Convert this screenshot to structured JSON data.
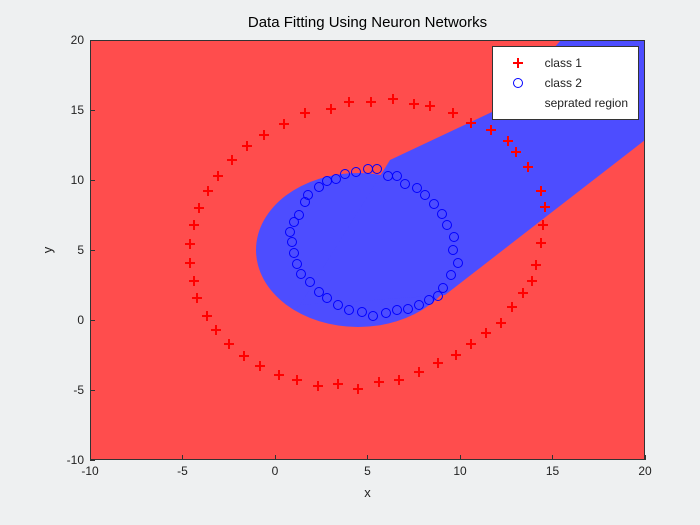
{
  "title": "Data Fitting Using Neuron Networks",
  "xlabel": "x",
  "ylabel": "y",
  "legend": {
    "class1": "class 1",
    "class2": "class 2",
    "region": "seprated region"
  },
  "chart_data": {
    "type": "scatter",
    "title": "Data Fitting Using Neuron Networks",
    "xlabel": "x",
    "ylabel": "y",
    "xlim": [
      -10,
      20
    ],
    "ylim": [
      -10,
      20
    ],
    "xticks": [
      -10,
      -5,
      0,
      5,
      10,
      15,
      20
    ],
    "yticks": [
      -10,
      -5,
      0,
      5,
      10,
      15,
      20
    ],
    "region": {
      "description": "Two classification regions. Red covers most of the plane; a rounded blue lobe centered near (4.5,5) with radius ~5.5 extends diagonally to the top-right corner as a band roughly 9 units wide.",
      "red_color": "#ff4d4d",
      "blue_color": "#4d4dff"
    },
    "series": [
      {
        "name": "class 1",
        "marker": "plus",
        "color": "#ff0000",
        "points": [
          [
            14.6,
            8.1
          ],
          [
            14.4,
            9.2
          ],
          [
            13.7,
            10.9
          ],
          [
            13.0,
            12.0
          ],
          [
            12.6,
            12.8
          ],
          [
            11.7,
            13.6
          ],
          [
            10.6,
            14.1
          ],
          [
            9.6,
            14.8
          ],
          [
            8.4,
            15.3
          ],
          [
            7.5,
            15.4
          ],
          [
            6.4,
            15.8
          ],
          [
            5.2,
            15.6
          ],
          [
            4.0,
            15.6
          ],
          [
            3.0,
            15.1
          ],
          [
            1.6,
            14.8
          ],
          [
            0.5,
            14.0
          ],
          [
            -0.6,
            13.2
          ],
          [
            -1.5,
            12.4
          ],
          [
            -2.3,
            11.4
          ],
          [
            -3.1,
            10.3
          ],
          [
            -3.6,
            9.2
          ],
          [
            -4.1,
            8.0
          ],
          [
            -4.4,
            6.8
          ],
          [
            -4.6,
            5.4
          ],
          [
            -4.6,
            4.1
          ],
          [
            -4.4,
            2.8
          ],
          [
            -4.2,
            1.6
          ],
          [
            -3.7,
            0.3
          ],
          [
            -3.2,
            -0.7
          ],
          [
            -2.5,
            -1.7
          ],
          [
            -1.7,
            -2.6
          ],
          [
            -0.8,
            -3.3
          ],
          [
            0.2,
            -3.9
          ],
          [
            1.2,
            -4.3
          ],
          [
            2.3,
            -4.7
          ],
          [
            3.4,
            -4.6
          ],
          [
            4.5,
            -4.9
          ],
          [
            5.6,
            -4.4
          ],
          [
            6.7,
            -4.3
          ],
          [
            7.8,
            -3.7
          ],
          [
            8.8,
            -3.1
          ],
          [
            9.8,
            -2.5
          ],
          [
            10.6,
            -1.7
          ],
          [
            11.4,
            -0.9
          ],
          [
            12.2,
            -0.2
          ],
          [
            12.8,
            0.9
          ],
          [
            13.4,
            1.9
          ],
          [
            13.9,
            2.8
          ],
          [
            14.1,
            3.9
          ],
          [
            14.4,
            5.5
          ],
          [
            14.5,
            6.8
          ]
        ]
      },
      {
        "name": "class 2",
        "marker": "circle",
        "color": "#0000ff",
        "points": [
          [
            9.9,
            4.1
          ],
          [
            9.6,
            5.0
          ],
          [
            9.7,
            5.9
          ],
          [
            9.3,
            6.8
          ],
          [
            9.0,
            7.6
          ],
          [
            8.6,
            8.3
          ],
          [
            8.1,
            8.9
          ],
          [
            7.7,
            9.4
          ],
          [
            7.0,
            9.7
          ],
          [
            6.6,
            10.3
          ],
          [
            6.1,
            10.3
          ],
          [
            5.5,
            10.8
          ],
          [
            5.0,
            10.8
          ],
          [
            4.4,
            10.6
          ],
          [
            3.8,
            10.4
          ],
          [
            3.3,
            10.1
          ],
          [
            2.8,
            9.9
          ],
          [
            2.4,
            9.5
          ],
          [
            1.8,
            8.9
          ],
          [
            1.6,
            8.4
          ],
          [
            1.3,
            7.5
          ],
          [
            1.0,
            7.0
          ],
          [
            0.8,
            6.3
          ],
          [
            0.9,
            5.6
          ],
          [
            1.0,
            4.8
          ],
          [
            1.2,
            4.0
          ],
          [
            1.4,
            3.3
          ],
          [
            1.9,
            2.7
          ],
          [
            2.4,
            2.0
          ],
          [
            2.8,
            1.6
          ],
          [
            3.4,
            1.1
          ],
          [
            4.0,
            0.7
          ],
          [
            4.7,
            0.6
          ],
          [
            5.3,
            0.3
          ],
          [
            6.0,
            0.5
          ],
          [
            6.6,
            0.7
          ],
          [
            7.2,
            0.8
          ],
          [
            7.8,
            1.1
          ],
          [
            8.3,
            1.4
          ],
          [
            8.8,
            1.7
          ],
          [
            9.1,
            2.3
          ],
          [
            9.5,
            3.2
          ]
        ]
      }
    ]
  }
}
